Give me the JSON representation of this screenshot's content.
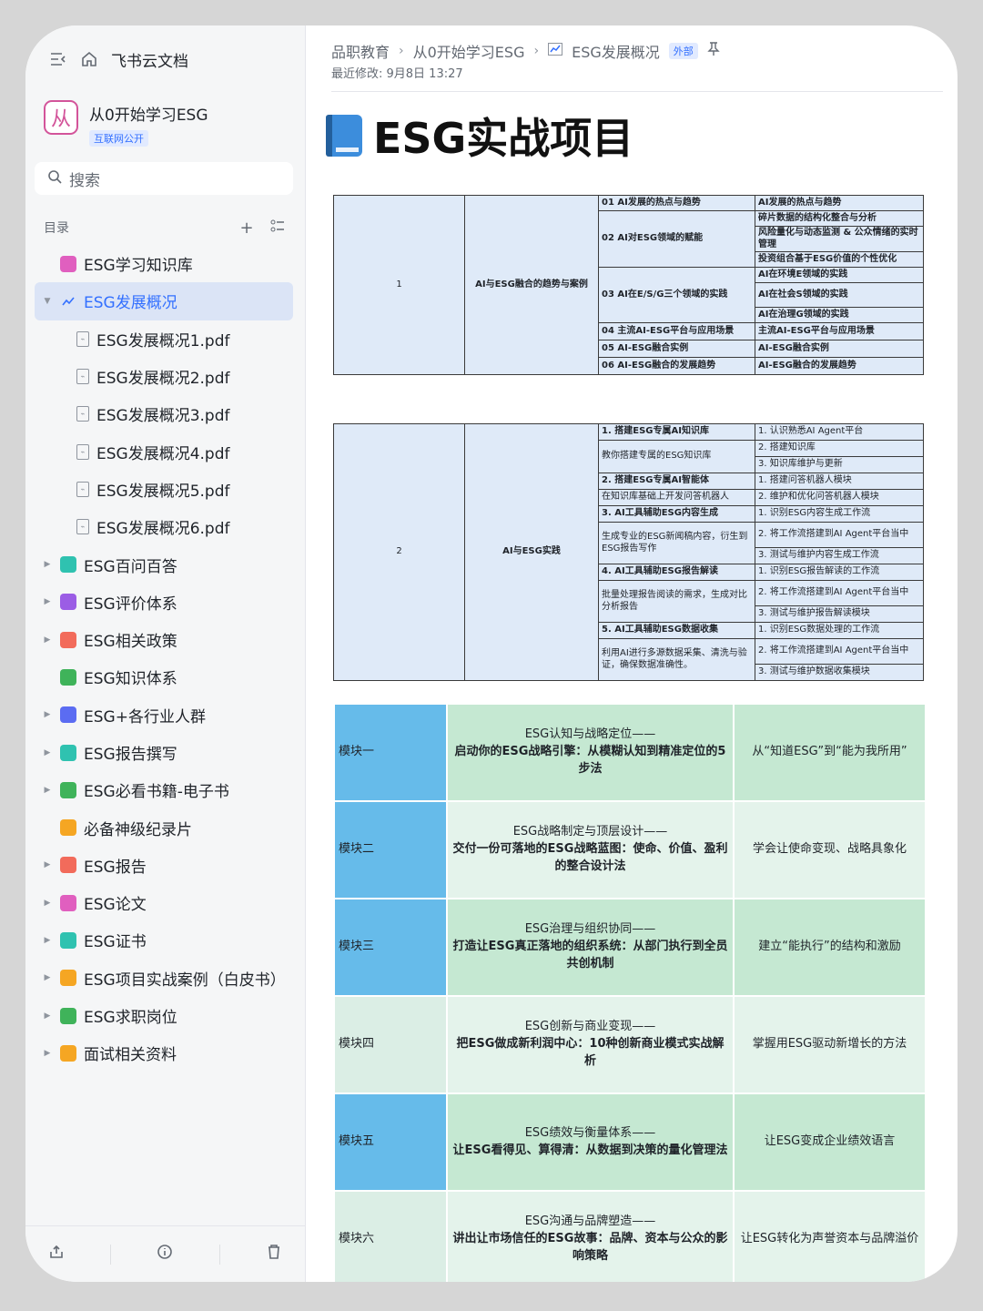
{
  "sidebar": {
    "brand": "飞书云文档",
    "workspace": {
      "name": "从0开始学习ESG",
      "logo_char": "从",
      "tag": "互联网公开"
    },
    "search_placeholder": "搜索",
    "toc_label": "目录",
    "items": [
      {
        "label": "ESG学习知识库",
        "color": "#e05fbf",
        "arrow": ""
      },
      {
        "label": "ESG发展概况",
        "color": "#3370ff",
        "arrow": "▼",
        "active": true
      },
      {
        "label": "ESG发展概况1.pdf",
        "child": true
      },
      {
        "label": "ESG发展概况2.pdf",
        "child": true
      },
      {
        "label": "ESG发展概况3.pdf",
        "child": true
      },
      {
        "label": "ESG发展概况4.pdf",
        "child": true
      },
      {
        "label": "ESG发展概况5.pdf",
        "child": true
      },
      {
        "label": "ESG发展概况6.pdf",
        "child": true
      },
      {
        "label": "ESG百问百答",
        "color": "#2fc2b0",
        "arrow": "▶"
      },
      {
        "label": "ESG评价体系",
        "color": "#9b5de5",
        "arrow": "▶"
      },
      {
        "label": "ESG相关政策",
        "color": "#f26b5b",
        "arrow": "▶"
      },
      {
        "label": "ESG知识体系",
        "color": "#3fb35a",
        "arrow": ""
      },
      {
        "label": "ESG+各行业人群",
        "color": "#5b6cf2",
        "arrow": "▶"
      },
      {
        "label": "ESG报告撰写",
        "color": "#2fc2b0",
        "arrow": "▶"
      },
      {
        "label": "ESG必看书籍-电子书",
        "color": "#3fb35a",
        "arrow": "▶"
      },
      {
        "label": "必备神级纪录片",
        "color": "#f5a623",
        "arrow": ""
      },
      {
        "label": "ESG报告",
        "color": "#f26b5b",
        "arrow": "▶"
      },
      {
        "label": "ESG论文",
        "color": "#e05fbf",
        "arrow": "▶"
      },
      {
        "label": "ESG证书",
        "color": "#2fc2b0",
        "arrow": "▶"
      },
      {
        "label": "ESG项目实战案例（白皮书）",
        "color": "#f5a623",
        "arrow": "▶"
      },
      {
        "label": "ESG求职岗位",
        "color": "#3fb35a",
        "arrow": "▶"
      },
      {
        "label": "面试相关资料",
        "color": "#f5a623",
        "arrow": "▶"
      }
    ]
  },
  "header": {
    "breadcrumb": [
      "品职教育",
      "从0开始学习ESG",
      "ESG发展概况"
    ],
    "external_tag": "外部",
    "modified": "最近修改: 9月8日 13:27"
  },
  "doc": {
    "title": "ESG实战项目",
    "table1": {
      "num": "1",
      "topic": "AI与ESG融合的趋势与案例",
      "rows": [
        [
          "01 AI发展的热点与趋势",
          "AI发展的热点与趋势"
        ],
        [
          "02 AI对ESG领域的赋能",
          "碎片数据的结构化整合与分析"
        ],
        [
          "",
          "风险量化与动态监测 & 公众情绪的实时管理"
        ],
        [
          "",
          "投资组合基于ESG价值的个性优化"
        ],
        [
          "03 AI在E/S/G三个领域的实践",
          "AI在环境E领域的实践"
        ],
        [
          "",
          "AI在社会S领域的实践"
        ],
        [
          "",
          "AI在治理G领域的实践"
        ],
        [
          "04 主流AI-ESG平台与应用场景",
          "主流AI-ESG平台与应用场景"
        ],
        [
          "05 AI-ESG融合实例",
          "AI-ESG融合实例"
        ],
        [
          "06 AI-ESG融合的发展趋势",
          "AI-ESG融合的发展趋势"
        ]
      ]
    },
    "table2": {
      "num": "2",
      "topic": "AI与ESG实践",
      "groups": [
        {
          "title": "1. 搭建ESG专属AI知识库",
          "desc": "教你搭建专属的ESG知识库",
          "steps": [
            "1. 认识熟悉AI Agent平台",
            "2. 搭建知识库",
            "3. 知识库维护与更新"
          ]
        },
        {
          "title": "2. 搭建ESG专属AI智能体",
          "desc": "在知识库基础上开发问答机器人",
          "steps": [
            "1. 搭建问答机器人模块",
            "2. 维护和优化问答机器人模块"
          ]
        },
        {
          "title": "3. AI工具辅助ESG内容生成",
          "desc": "生成专业的ESG新闻稿内容，衍生到ESG报告写作",
          "steps": [
            "1. 识别ESG内容生成工作流",
            "2. 将工作流搭建到AI Agent平台当中",
            "3. 测试与维护内容生成工作流"
          ]
        },
        {
          "title": "4. AI工具辅助ESG报告解读",
          "desc": "批量处理报告阅读的需求，生成对比分析报告",
          "steps": [
            "1. 识别ESG报告解读的工作流",
            "2. 将工作流搭建到AI Agent平台当中",
            "3. 测试与维护报告解读模块"
          ]
        },
        {
          "title": "5. AI工具辅助ESG数据收集",
          "desc": "利用AI进行多源数据采集、清洗与验证，确保数据准确性。",
          "steps": [
            "1. 识别ESG数据处理的工作流",
            "2. 将工作流搭建到AI Agent平台当中",
            "3. 测试与维护数据收集模块"
          ]
        }
      ]
    },
    "modules": [
      {
        "name": "模块一",
        "subtitle": "ESG认知与战略定位——",
        "headline": "启动你的ESG战略引擎：从模糊认知到精准定位的5步法",
        "goal": "从“知道ESG”到“能为我所用”"
      },
      {
        "name": "模块二",
        "subtitle": "ESG战略制定与顶层设计——",
        "headline": "交付一份可落地的ESG战略蓝图：使命、价值、盈利的整合设计法",
        "goal": "学会让使命变现、战略具象化"
      },
      {
        "name": "模块三",
        "subtitle": "ESG治理与组织协同——",
        "headline": "打造让ESG真正落地的组织系统：从部门执行到全员共创机制",
        "goal": "建立“能执行”的结构和激励"
      },
      {
        "name": "模块四",
        "subtitle": "ESG创新与商业变现——",
        "headline": "把ESG做成新利润中心：10种创新商业模式实战解析",
        "goal": "掌握用ESG驱动新增长的方法"
      },
      {
        "name": "模块五",
        "subtitle": "ESG绩效与衡量体系——",
        "headline": "让ESG看得见、算得清：从数据到决策的量化管理法",
        "goal": "让ESG变成企业绩效语言"
      },
      {
        "name": "模块六",
        "subtitle": "ESG沟通与品牌塑造——",
        "headline": "讲出让市场信任的ESG故事：品牌、资本与公众的影响策略",
        "goal": "让ESG转化为声誉资本与品牌溢价"
      }
    ]
  }
}
